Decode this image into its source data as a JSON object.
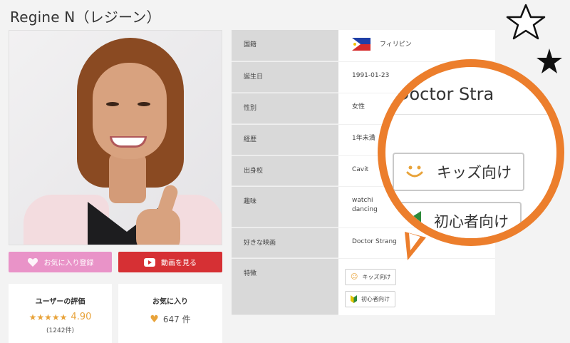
{
  "teacher": {
    "name": "Regine N（レジーン）"
  },
  "actions": {
    "favorite_label": "お気に入り登録",
    "video_label": "動画を見る"
  },
  "rating": {
    "title": "ユーザーの評価",
    "score": "4.90",
    "stars": 5,
    "count": "(1242件)"
  },
  "favorites": {
    "title": "お気に入り",
    "count": "647 件"
  },
  "profile": {
    "rows": [
      {
        "label": "国籍",
        "value": "フィリピン"
      },
      {
        "label": "誕生日",
        "value": "1991-01-23"
      },
      {
        "label": "性別",
        "value": "女性"
      },
      {
        "label": "経歴",
        "value": "1年未満"
      },
      {
        "label": "出身校",
        "value": "Cavit"
      },
      {
        "label": "趣味",
        "value": "watchi\ndancing"
      },
      {
        "label": "好きな映画",
        "value": "Doctor Strang"
      },
      {
        "label": "特徴",
        "value": ""
      }
    ],
    "tags": [
      "キッズ向け",
      "初心者向け"
    ]
  },
  "magnifier": {
    "background_text": "Doctor Stra",
    "tags": [
      "キッズ向け",
      "初心者向け"
    ]
  },
  "colors": {
    "accent": "#ec7e2c",
    "favorite": "#e993c8",
    "video": "#d63034",
    "star": "#e8a33a"
  },
  "icons": {
    "favorite": "heart-icon",
    "video": "play-icon",
    "kids": "smile-icon",
    "beginner": "beginner-mark-icon",
    "nationality": "philippines-flag-icon"
  }
}
